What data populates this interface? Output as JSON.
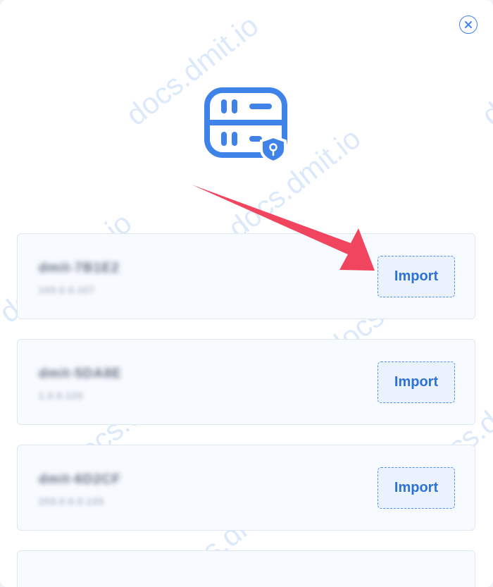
{
  "dialog": {
    "close_glyph": "×",
    "hero_icon": "server-shield-icon",
    "accent_color": "#3f83e8",
    "arrow_color": "#f0445f"
  },
  "servers": [
    {
      "name": "dmit-7B1E2",
      "ip": "103.0.0.107",
      "import_label": "Import"
    },
    {
      "name": "dmit-5DA8E",
      "ip": "1.0.0.120",
      "import_label": "Import"
    },
    {
      "name": "dmit-6D2CF",
      "ip": "203.0.0.0.133",
      "import_label": "Import"
    }
  ],
  "watermark": {
    "text": "docs.dmit.io"
  }
}
